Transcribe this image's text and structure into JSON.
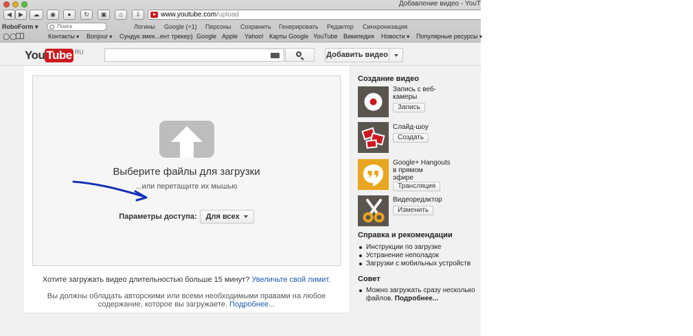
{
  "browser": {
    "window_title": "Добавление видео - YouT",
    "url_domain": "www.youtube.com",
    "url_path": "/upload",
    "bookmarks_row1": [
      "Логины",
      "Google (+1)",
      "Персоны",
      "Сохранить",
      "Генерировать",
      "Редактор",
      "Синхронизация"
    ],
    "roboform_label": "RoboForm",
    "search_placeholder": "Поиск",
    "bookmarks_row2": [
      "Контакты",
      "Bonjour",
      "Сундук змек...ент трекер)",
      "Google",
      "Apple",
      "Yahoo!",
      "Карты Google",
      "YouTube",
      "Википедия",
      "Новости",
      "Популярные ресурсы"
    ]
  },
  "header": {
    "logo_you": "You",
    "logo_tube": "Tube",
    "logo_region": "RU",
    "upload_button": "Добавить видео"
  },
  "upload": {
    "title": "Выберите файлы для загрузки",
    "subtitle": "...или перетащите их мышью",
    "access_label": "Параметры доступа:",
    "access_value": "Для всех",
    "limit_text": "Хотите загружать видео длительностью больше 15 минут?",
    "limit_link": "Увеличьте свой лимит.",
    "rights_text": "Вы должны обладать авторскими или всеми необходимыми правами на любое содержание, которое вы загружаете.",
    "rights_link": "Подробнее..."
  },
  "sidebar": {
    "create_heading": "Создание видео",
    "tools": [
      {
        "title_lines": [
          "Запись с веб-",
          "камеры"
        ],
        "button": "Запись",
        "icon": "webcam-record-icon"
      },
      {
        "title_lines": [
          "Слайд-шоу"
        ],
        "button": "Создать",
        "icon": "slideshow-photos-icon"
      },
      {
        "title_lines": [
          "Google+ Hangouts",
          "в прямом",
          "эфире"
        ],
        "button": "Трансляция",
        "icon": "hangouts-quote-icon"
      },
      {
        "title_lines": [
          "Видеоредактор"
        ],
        "button": "Изменить",
        "icon": "scissors-icon"
      }
    ],
    "help_heading": "Справка и рекомендации",
    "help_items": [
      "Инструкции по загрузке",
      "Устранение неполадок",
      "Загрузки с мобильных устройств"
    ],
    "tip_heading": "Совет",
    "tip_lines": [
      "Можно загружать сразу несколько",
      "файлов."
    ],
    "tip_link": "Подробнее..."
  },
  "colors": {
    "youtube_red": "#cc181e",
    "link_blue": "#1b5aaa",
    "tile_dark": "#5b554f",
    "hangouts_orange": "#e9a620",
    "annotation_arrow": "#1432b4"
  }
}
